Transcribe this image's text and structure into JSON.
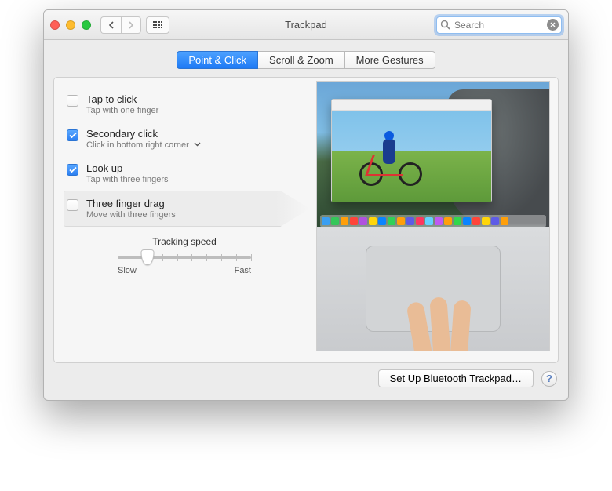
{
  "window": {
    "title": "Trackpad"
  },
  "search": {
    "placeholder": "Search",
    "value": ""
  },
  "tabs": [
    {
      "label": "Point & Click",
      "active": true
    },
    {
      "label": "Scroll & Zoom",
      "active": false
    },
    {
      "label": "More Gestures",
      "active": false
    }
  ],
  "options": {
    "tap_to_click": {
      "label": "Tap to click",
      "sub": "Tap with one finger",
      "checked": false
    },
    "secondary_click": {
      "label": "Secondary click",
      "sub": "Click in bottom right corner",
      "checked": true
    },
    "look_up": {
      "label": "Look up",
      "sub": "Tap with three fingers",
      "checked": true
    },
    "three_finger_drag": {
      "label": "Three finger drag",
      "sub": "Move with three fingers",
      "checked": false
    }
  },
  "slider": {
    "title": "Tracking speed",
    "min_label": "Slow",
    "max_label": "Fast",
    "ticks": 10,
    "value": 3
  },
  "footer": {
    "bluetooth_button": "Set Up Bluetooth Trackpad…"
  },
  "dock_colors": [
    "#3a9ff2",
    "#34c759",
    "#ff9f0a",
    "#ff453a",
    "#af52de",
    "#ffd60a",
    "#0a84ff",
    "#30d158",
    "#ff9f0a",
    "#5e5ce6",
    "#ff375f",
    "#64d2ff",
    "#bf5af2",
    "#ff9f0a",
    "#32d74b",
    "#0a84ff",
    "#ff453a",
    "#ffd60a",
    "#5e5ce6",
    "#ff9f0a"
  ]
}
